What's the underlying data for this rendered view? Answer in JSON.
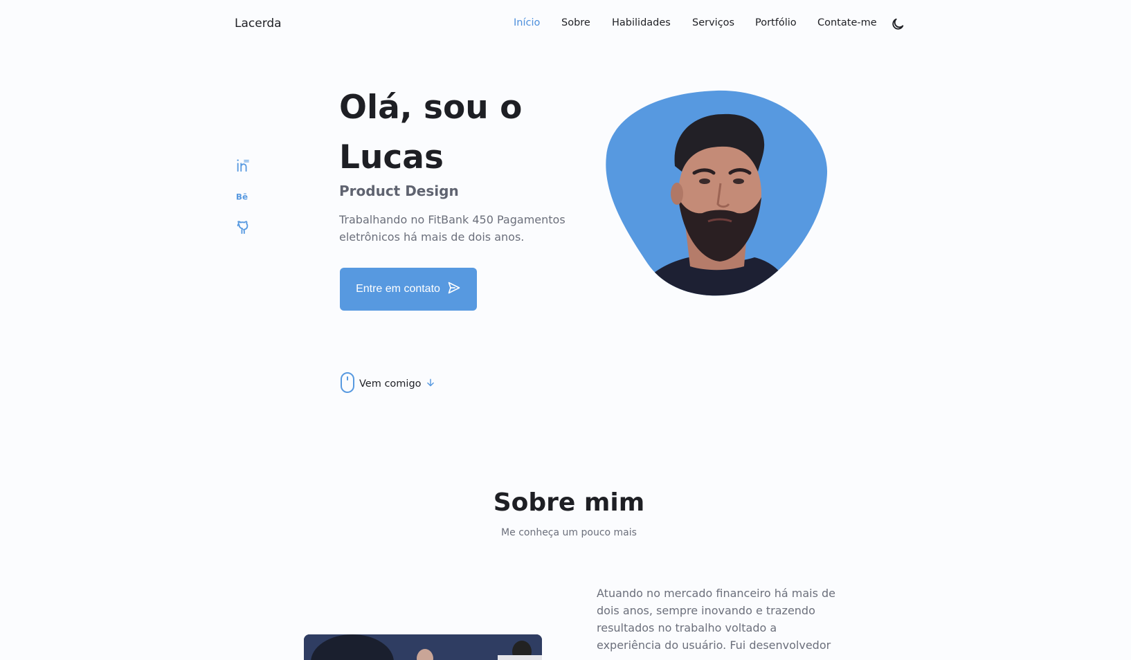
{
  "header": {
    "logo": "Lacerda",
    "nav": [
      {
        "label": "Início",
        "active": true
      },
      {
        "label": "Sobre",
        "active": false
      },
      {
        "label": "Habilidades",
        "active": false
      },
      {
        "label": "Serviços",
        "active": false
      },
      {
        "label": "Portfólio",
        "active": false
      },
      {
        "label": "Contate-me",
        "active": false
      }
    ],
    "theme_icon": "moon-icon"
  },
  "social": [
    {
      "icon": "linkedin-icon"
    },
    {
      "icon": "behance-icon"
    },
    {
      "icon": "github-icon"
    }
  ],
  "hero": {
    "title": "Olá, sou o Lucas",
    "subtitle": "Product Design",
    "description": "Trabalhando no FitBank 450 Pagamentos eletrônicos há mais de dois anos.",
    "cta_label": "Entre em contato",
    "cta_icon": "send-icon",
    "scroll_label": "Vem comigo",
    "scroll_icon": "mouse-icon",
    "image_desc": "profile-photo"
  },
  "about": {
    "title": "Sobre mim",
    "subtitle": "Me conheça um pouco mais",
    "text": "Atuando no mercado financeiro há mais de dois anos, sempre inovando e trazendo resultados no trabalho voltado a experiência do usuário. Fui desenvolvedor"
  },
  "colors": {
    "accent": "#5799e0",
    "text": "#1e1f24",
    "muted": "#6b6f7b",
    "background": "#fbfcfe"
  }
}
